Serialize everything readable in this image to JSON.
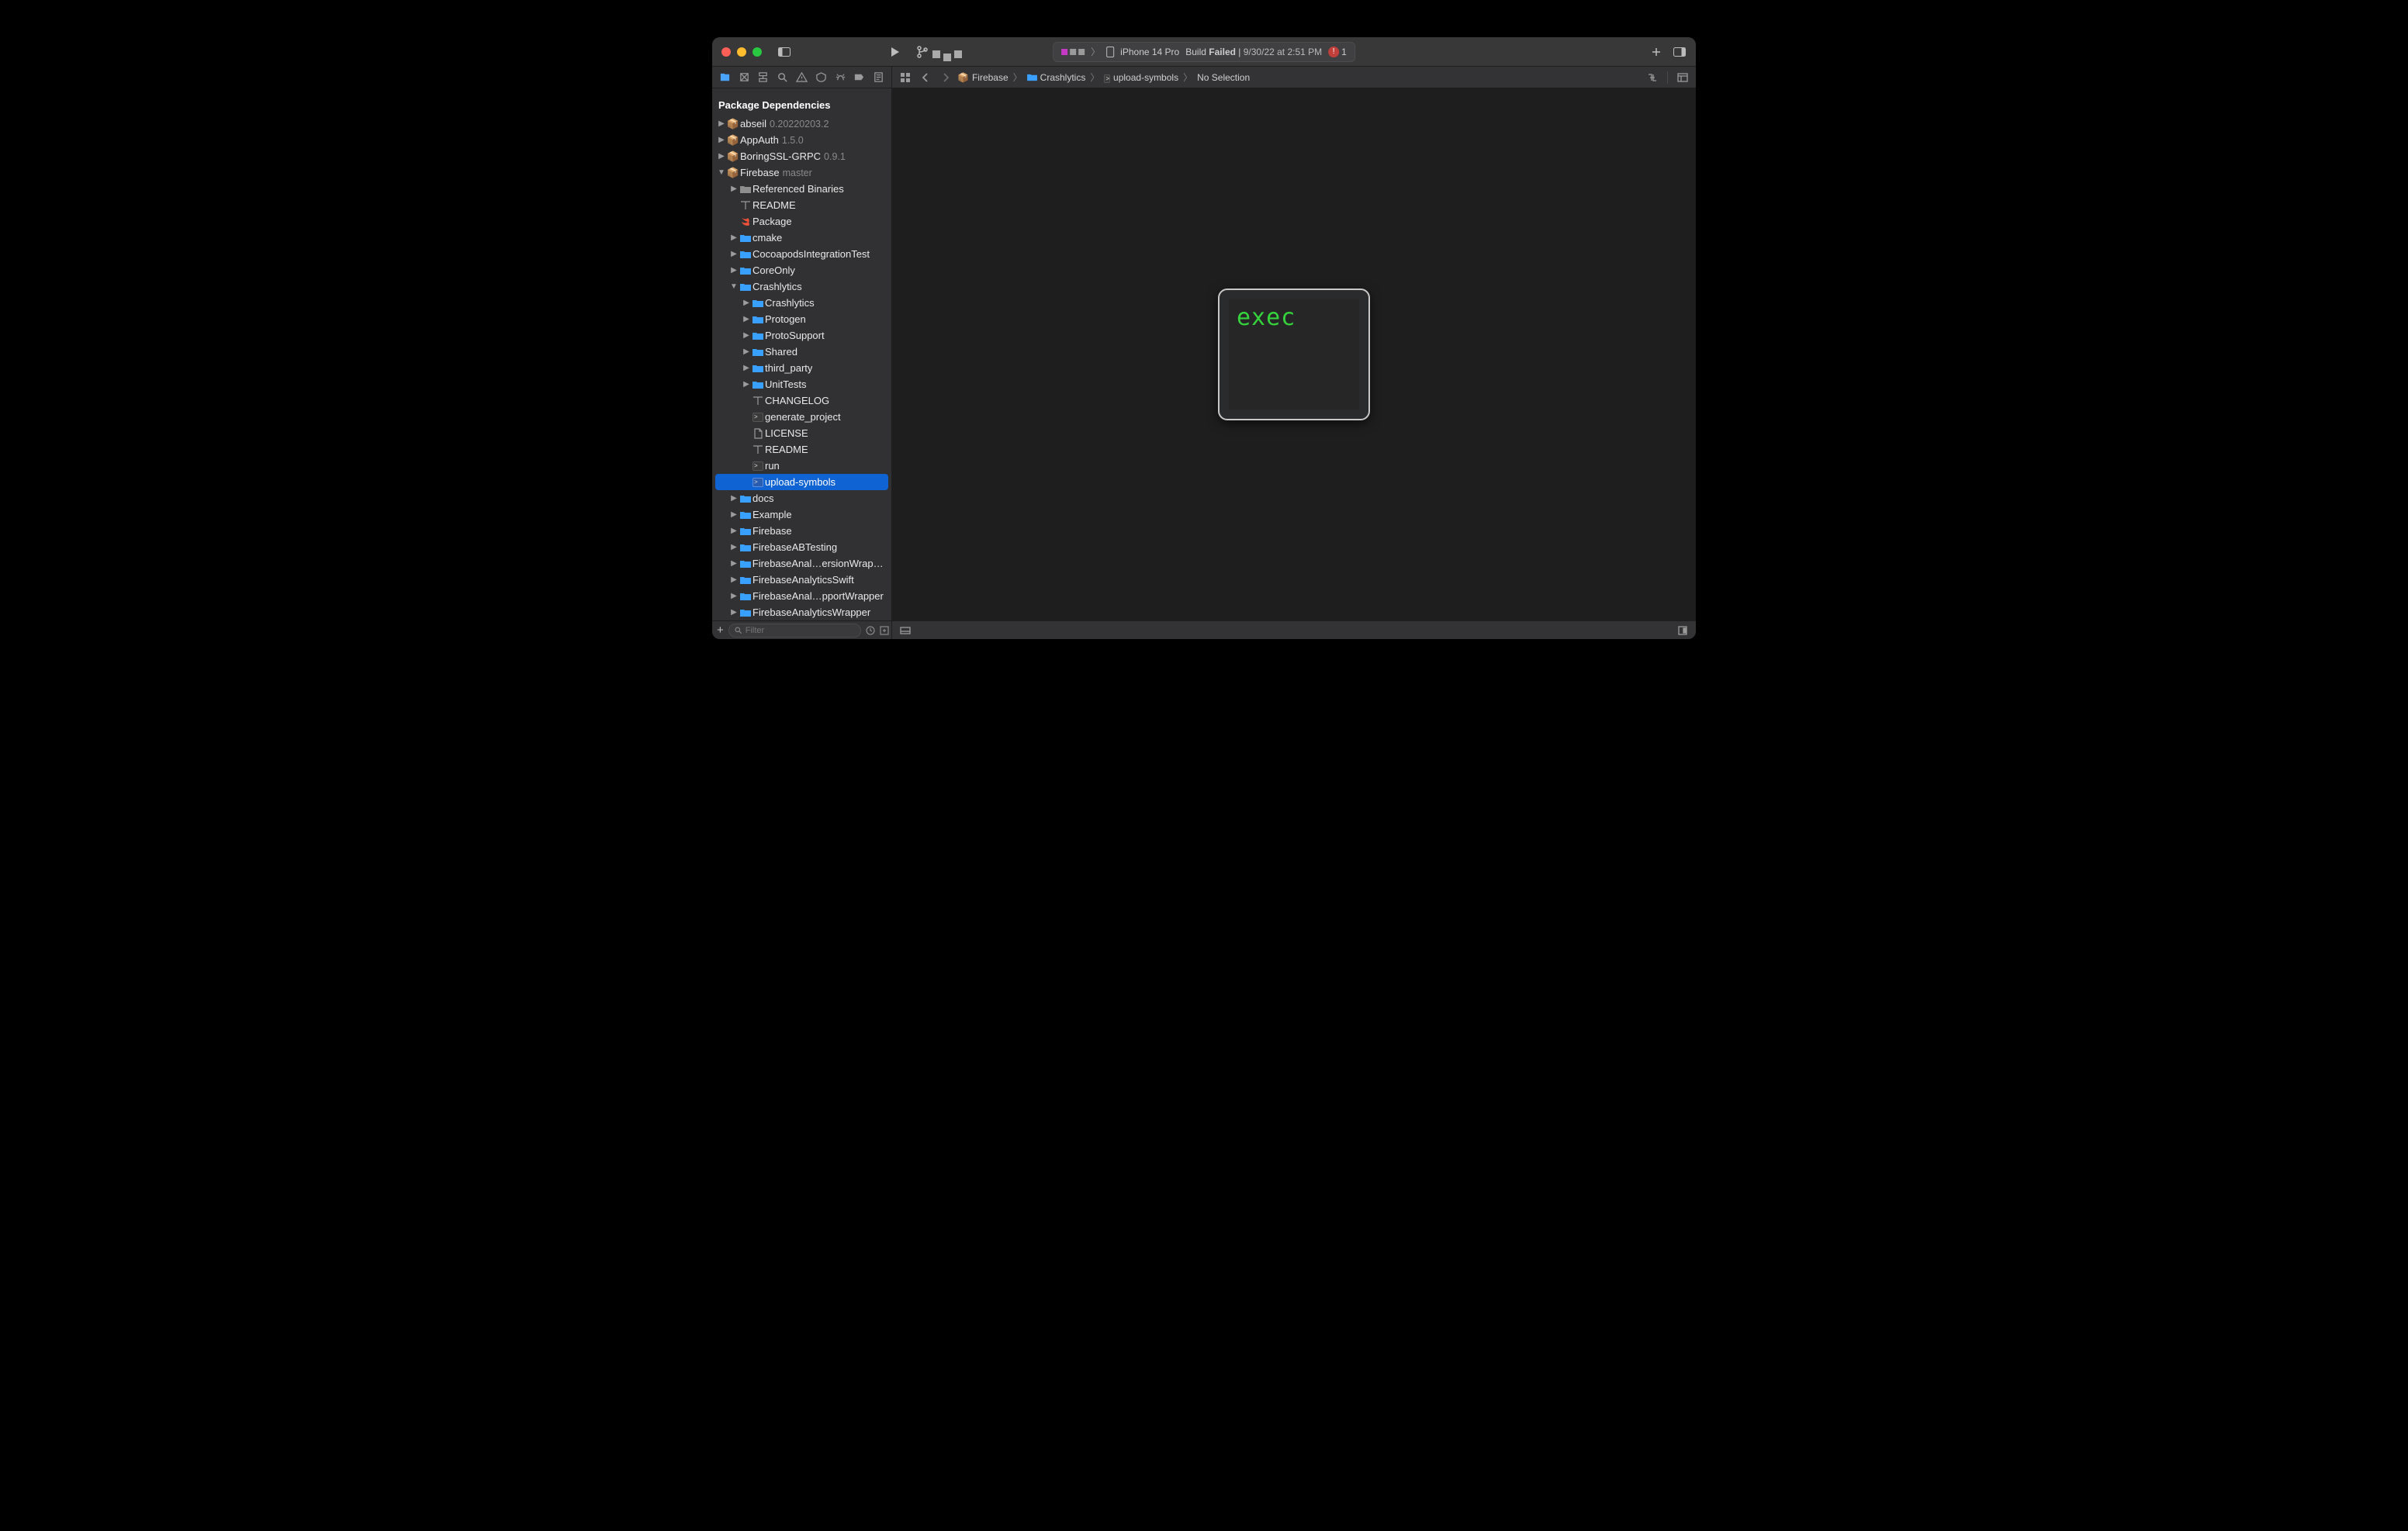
{
  "toolbar": {
    "device": "iPhone 14 Pro",
    "build_status_prefix": "Build ",
    "build_status_word": "Failed",
    "build_sep": " | ",
    "timestamp": "9/30/22 at 2:51 PM",
    "error_count": "1"
  },
  "navigator": {
    "title": "Package Dependencies",
    "filter_placeholder": "Filter"
  },
  "packages": [
    {
      "name": "abseil",
      "version": "0.20220203.2"
    },
    {
      "name": "AppAuth",
      "version": "1.5.0"
    },
    {
      "name": "BoringSSL-GRPC",
      "version": "0.9.1"
    },
    {
      "name": "Firebase",
      "version": "master"
    }
  ],
  "firebase_children": {
    "ref_bin": "Referenced Binaries",
    "readme": "README",
    "package": "Package",
    "cmake": "cmake",
    "cocoapods": "CocoapodsIntegrationTest",
    "coreonly": "CoreOnly",
    "crashlytics": "Crashlytics",
    "docs": "docs",
    "example": "Example",
    "firebase": "Firebase",
    "fabtesting": "FirebaseABTesting",
    "fanal_ext": "FirebaseAnal…ersionWrapper",
    "fanal_swift": "FirebaseAnalyticsSwift",
    "fanal_supp": "FirebaseAnal…pportWrapper",
    "fanal_wrap": "FirebaseAnalyticsWrapper"
  },
  "crashlytics_children": {
    "crashlytics": "Crashlytics",
    "protogen": "Protogen",
    "protosupport": "ProtoSupport",
    "shared": "Shared",
    "thirdparty": "third_party",
    "unittests": "UnitTests",
    "changelog": "CHANGELOG",
    "genproj": "generate_project",
    "license": "LICENSE",
    "readme": "README",
    "run": "run",
    "upload": "upload-symbols"
  },
  "jumpbar": {
    "c1": "Firebase",
    "c2": "Crashlytics",
    "c3": "upload-symbols",
    "c4": "No Selection"
  },
  "exec_label": "exec"
}
